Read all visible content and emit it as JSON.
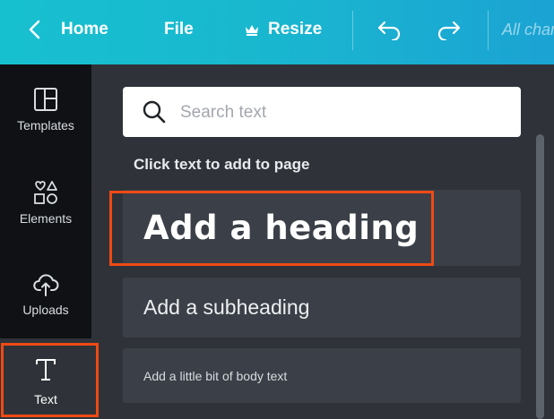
{
  "toolbar": {
    "home_label": "Home",
    "file_label": "File",
    "resize_label": "Resize",
    "saved_status": "All changes saved",
    "icons": {
      "back": "chevron-left-icon",
      "crown": "crown-icon",
      "undo": "undo-icon",
      "redo": "redo-icon"
    },
    "colors": {
      "gradient_start": "#17c0cf",
      "gradient_end": "#1ba3d3"
    }
  },
  "sidebar": {
    "items": [
      {
        "label": "Templates",
        "icon": "templates-icon"
      },
      {
        "label": "Elements",
        "icon": "elements-icon"
      },
      {
        "label": "Uploads",
        "icon": "upload-cloud-icon"
      },
      {
        "label": "Text",
        "icon": "text-icon",
        "active": true
      }
    ]
  },
  "panel": {
    "search": {
      "placeholder": "Search text",
      "value": "",
      "icon": "search-icon"
    },
    "section_title": "Click text to add to page",
    "text_options": [
      {
        "label": "Add a heading"
      },
      {
        "label": "Add a subheading"
      },
      {
        "label": "Add a little bit of body text"
      }
    ]
  },
  "highlight_color": "#ef4a14"
}
